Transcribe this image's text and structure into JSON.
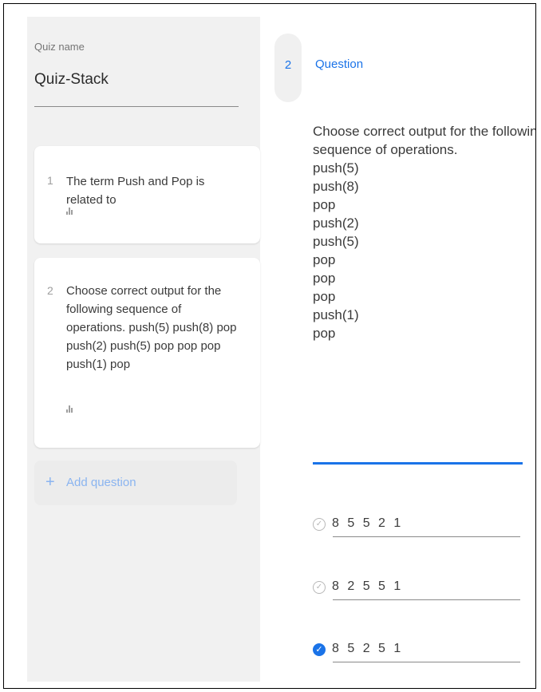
{
  "sidebar": {
    "quiz_name_label": "Quiz name",
    "quiz_name_value": "Quiz-Stack",
    "questions": [
      {
        "number": "1",
        "text": "The term Push and Pop is related to"
      },
      {
        "number": "2",
        "text": "Choose correct output for the following sequence of operations. push(5) push(8) pop push(2) push(5) pop pop pop push(1) pop"
      }
    ],
    "add_question": {
      "icon": "+",
      "label": "Add question"
    }
  },
  "editor": {
    "number": "2",
    "label": "Question",
    "text_lines": [
      "Choose correct output for the following",
      "sequence of operations.",
      "push(5)",
      "push(8)",
      "pop",
      "push(2)",
      "push(5)",
      "pop",
      "pop",
      "pop",
      "push(1)",
      "pop"
    ],
    "options": [
      {
        "text": "8 5 5 2 1",
        "correct": false
      },
      {
        "text": "8 2 5 5 1",
        "correct": false
      },
      {
        "text": "8 5 2 5 1",
        "correct": true
      }
    ]
  },
  "colors": {
    "accent": "#1a73e8",
    "sidebar_bg": "#f1f1f1",
    "add_question": "#8ab4f0"
  }
}
